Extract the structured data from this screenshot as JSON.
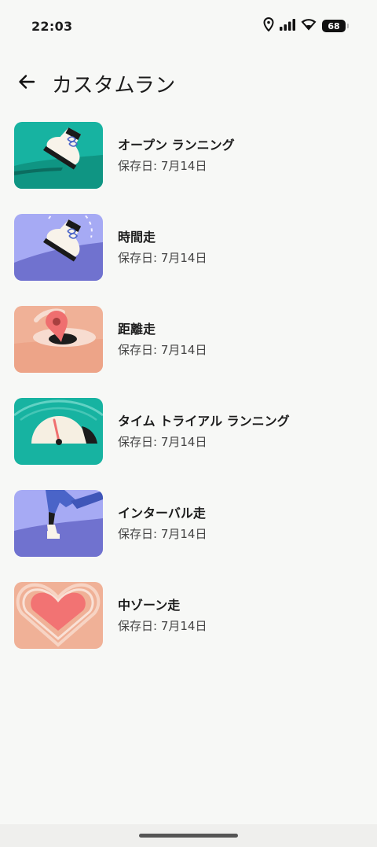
{
  "status_bar": {
    "time": "22:03",
    "battery": "68",
    "icons": [
      "location-icon",
      "signal-icon",
      "wifi-icon",
      "battery-icon"
    ]
  },
  "header": {
    "title": "カスタムラン",
    "back_icon": "arrow-left-icon"
  },
  "runs": [
    {
      "title": "オープン ランニング",
      "saved": "保存日: 7月14日",
      "thumb": "shoe-teal",
      "colors": [
        "#19b3a1",
        "#0d8e7e"
      ]
    },
    {
      "title": "時間走",
      "saved": "保存日: 7月14日",
      "thumb": "shoe-stopwatch-purple",
      "colors": [
        "#a5a9f4",
        "#7275cf"
      ]
    },
    {
      "title": "距離走",
      "saved": "保存日: 7月14日",
      "thumb": "location-pin-peach",
      "colors": [
        "#f1b198",
        "#ef7070"
      ]
    },
    {
      "title": "タイム トライアル ランニング",
      "saved": "保存日: 7月14日",
      "thumb": "gauge-teal",
      "colors": [
        "#19b3a1",
        "#f5eee0"
      ]
    },
    {
      "title": "インターバル走",
      "saved": "保存日: 7月14日",
      "thumb": "runner-legs-purple",
      "colors": [
        "#a5a9f4",
        "#4b62c4"
      ]
    },
    {
      "title": "中ゾーン走",
      "saved": "保存日: 7月14日",
      "thumb": "heart-peach",
      "colors": [
        "#f1b198",
        "#f27474"
      ]
    }
  ]
}
